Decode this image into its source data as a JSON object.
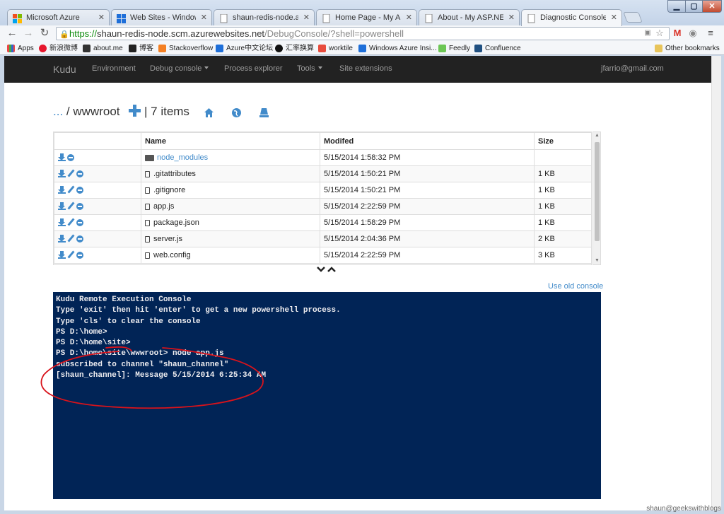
{
  "browser": {
    "tabs": [
      {
        "title": "Microsoft Azure",
        "favicon_color": "#e74c3c"
      },
      {
        "title": "Web Sites - Windows Azu",
        "favicon_color": "#1e90ff"
      },
      {
        "title": "shaun-redis-node.azurew",
        "favicon_color": "#cccccc"
      },
      {
        "title": "Home Page - My ASP.NET",
        "favicon_color": "#cccccc"
      },
      {
        "title": "About - My ASP.NET Appl",
        "favicon_color": "#cccccc"
      },
      {
        "title": "Diagnostic Console",
        "favicon_color": "#cccccc"
      }
    ],
    "url": {
      "scheme": "https://",
      "host": "shaun-redis-node.scm.azurewebsites.net",
      "path": "/DebugConsole/?shell=powershell"
    },
    "bookmarks": [
      "Apps",
      "新浪微博",
      "about.me",
      "博客",
      "Stackoverflow",
      "Azure中文论坛",
      "汇率换算",
      "worktile",
      "Windows Azure Insi...",
      "Feedly",
      "Confluence"
    ],
    "other_bookmarks": "Other bookmarks"
  },
  "kudu": {
    "brand": "Kudu",
    "nav": [
      "Environment",
      "Debug console",
      "Process explorer",
      "Tools",
      "Site extensions"
    ],
    "user": "jfarrio@gmail.com",
    "breadcrumb": {
      "dots": "...",
      "separator": "/",
      "folder": "wwwroot",
      "count": "| 7 items"
    },
    "table": {
      "headers": [
        "",
        "Name",
        "Modifed",
        "Size"
      ],
      "rows": [
        {
          "name": "node_modules",
          "modified": "5/15/2014 1:58:32 PM",
          "size": ""
        },
        {
          "name": ".gitattributes",
          "modified": "5/15/2014 1:50:21 PM",
          "size": "1 KB"
        },
        {
          "name": ".gitignore",
          "modified": "5/15/2014 1:50:21 PM",
          "size": "1 KB"
        },
        {
          "name": "app.js",
          "modified": "5/15/2014 2:22:59 PM",
          "size": "1 KB"
        },
        {
          "name": "package.json",
          "modified": "5/15/2014 1:58:29 PM",
          "size": "1 KB"
        },
        {
          "name": "server.js",
          "modified": "5/15/2014 2:04:36 PM",
          "size": "2 KB"
        },
        {
          "name": "web.config",
          "modified": "5/15/2014 2:22:59 PM",
          "size": "3 KB"
        }
      ]
    },
    "old_console_link": "Use old console",
    "console_lines": [
      "Kudu Remote Execution Console",
      "Type 'exit' then hit 'enter' to get a new powershell process.",
      "Type 'cls' to clear the console",
      "",
      "PS D:\\home>",
      "PS D:\\home\\site>",
      "PS D:\\home\\site\\wwwroot> node app.js",
      "subscribed to channel \"shaun_channel\"",
      "[shaun_channel]: Message 5/15/2014 6:25:34 AM"
    ],
    "console_bg": "#012456"
  },
  "watermark": "shaun@geekswithblogs",
  "accent": "#428bca",
  "annotation_color": "#d8131b"
}
